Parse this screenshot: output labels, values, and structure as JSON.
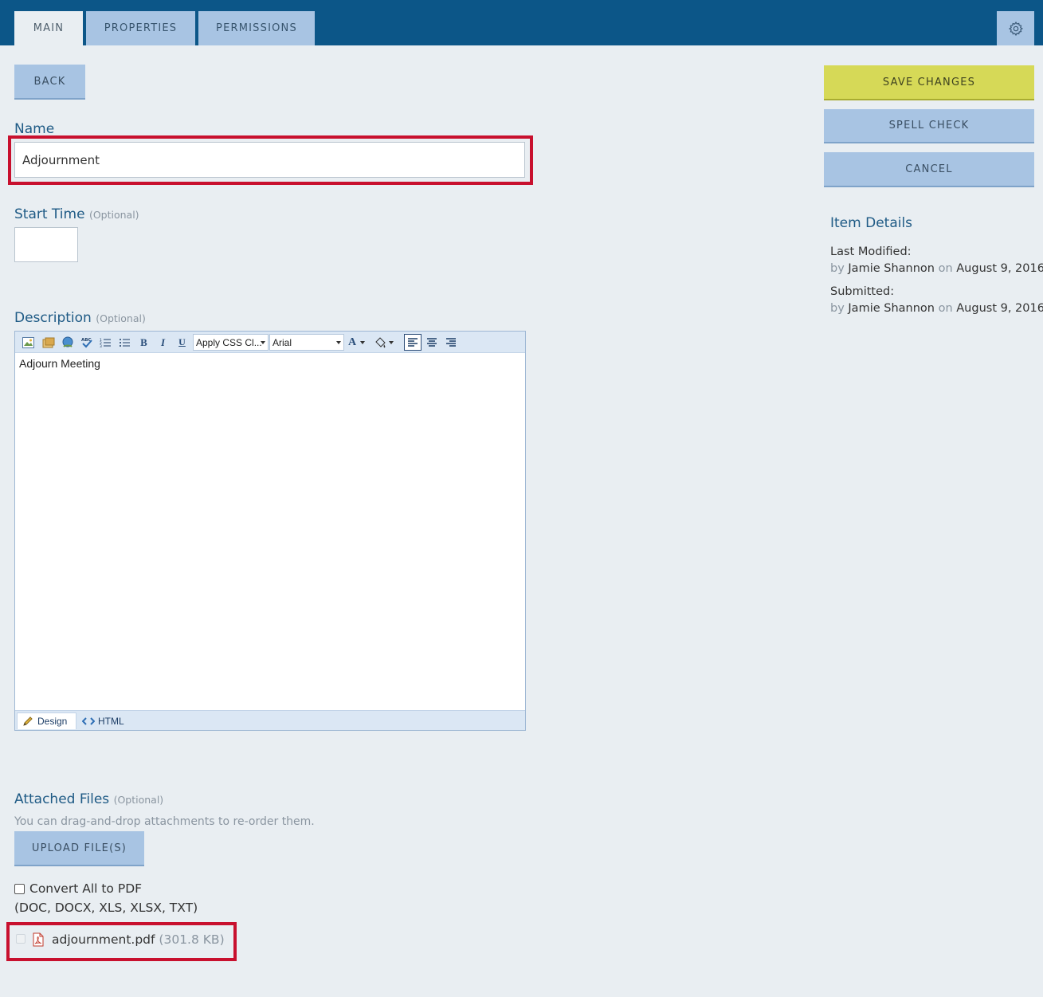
{
  "tabs": [
    {
      "label": "MAIN"
    },
    {
      "label": "PROPERTIES"
    },
    {
      "label": "PERMISSIONS"
    }
  ],
  "buttons": {
    "back": "BACK",
    "save": "SAVE CHANGES",
    "spell_check": "SPELL CHECK",
    "cancel": "CANCEL",
    "upload": "UPLOAD FILE(S)"
  },
  "form": {
    "name_label": "Name",
    "name_value": "Adjournment",
    "start_time_label": "Start Time",
    "optional": "(Optional)",
    "start_time_value": "",
    "description_label": "Description",
    "description_text": "Adjourn Meeting",
    "css_class_select": "Apply CSS Cl...",
    "font_select": "Arial",
    "mode_design": "Design",
    "mode_html": "HTML",
    "attached_label": "Attached Files",
    "attached_hint": "You can drag-and-drop attachments to re-order them.",
    "convert_label": "Convert All to PDF",
    "convert_types": "(DOC, DOCX, XLS, XLSX, TXT)"
  },
  "attachment": {
    "filename": "adjournment.pdf",
    "size": "(301.8 KB)"
  },
  "details": {
    "title": "Item Details",
    "last_modified_label": "Last Modified:",
    "submitted_label": "Submitted:",
    "by": "by",
    "on": "on",
    "modified_user": "Jamie Shannon",
    "modified_date": "August 9, 2016",
    "submitted_user": "Jamie Shannon",
    "submitted_date": "August 9, 2016"
  },
  "colors": {
    "header": "#0c5688",
    "tab": "#a8c4e3",
    "save": "#d6d957",
    "highlight": "#c8102e"
  }
}
